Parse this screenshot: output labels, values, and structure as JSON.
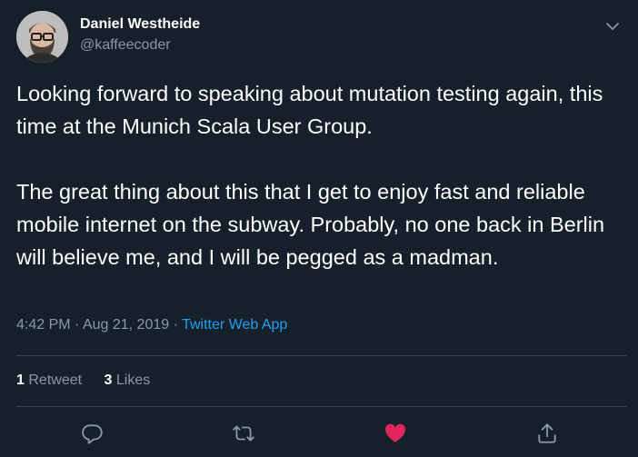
{
  "user": {
    "display_name": "Daniel Westheide",
    "handle": "@kaffeecoder"
  },
  "tweet": {
    "paragraphs": [
      "Looking forward to speaking about mutation testing again, this time at the Munich Scala User Group.",
      "The great thing about this that I get to enjoy fast and reliable mobile internet on the subway. Probably, no one back in Berlin will believe me, and I will be pegged as a madman."
    ],
    "time": "4:42 PM",
    "date": "Aug 21, 2019",
    "separator": "·",
    "source": "Twitter Web App"
  },
  "stats": {
    "retweets_count": "1",
    "retweets_label": "Retweet",
    "likes_count": "3",
    "likes_label": "Likes"
  },
  "actions": {
    "reply_icon": "reply-icon",
    "retweet_icon": "retweet-icon",
    "like_icon": "heart-icon",
    "share_icon": "share-icon"
  },
  "colors": {
    "background": "#15202b",
    "text_primary": "#ffffff",
    "text_secondary": "#8899a6",
    "link": "#1da1f2",
    "like_active": "#e0245e",
    "divider": "#38444d"
  }
}
